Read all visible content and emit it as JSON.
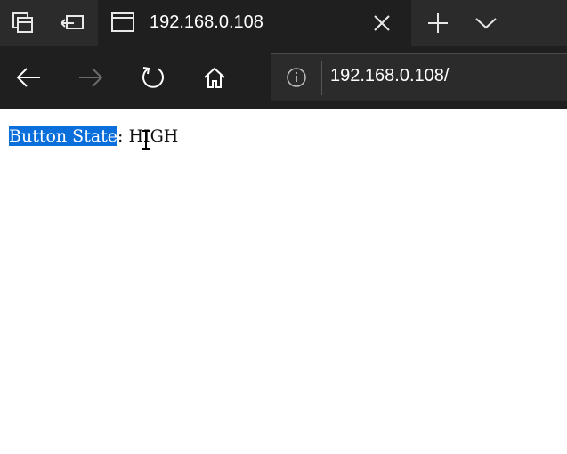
{
  "browser": {
    "tab": {
      "title": "192.168.0.108"
    },
    "address": {
      "url": "192.168.0.108/"
    },
    "icons": {
      "tab_actions": "tab-actions-icon",
      "set_aside": "set-aside-tabs-icon",
      "tab_page": "page-icon",
      "close": "close-icon",
      "new_tab": "plus-icon",
      "tab_list": "chevron-down-icon",
      "back": "back-arrow-icon",
      "forward": "forward-arrow-icon",
      "refresh": "refresh-icon",
      "home": "home-icon",
      "info": "info-icon"
    }
  },
  "page": {
    "selected_text": "Button State",
    "rest_text": ": HIGH"
  },
  "colors": {
    "titlebar": "#2b2b2b",
    "toolbar": "#1f1f1f",
    "selection": "#0a6edb"
  }
}
